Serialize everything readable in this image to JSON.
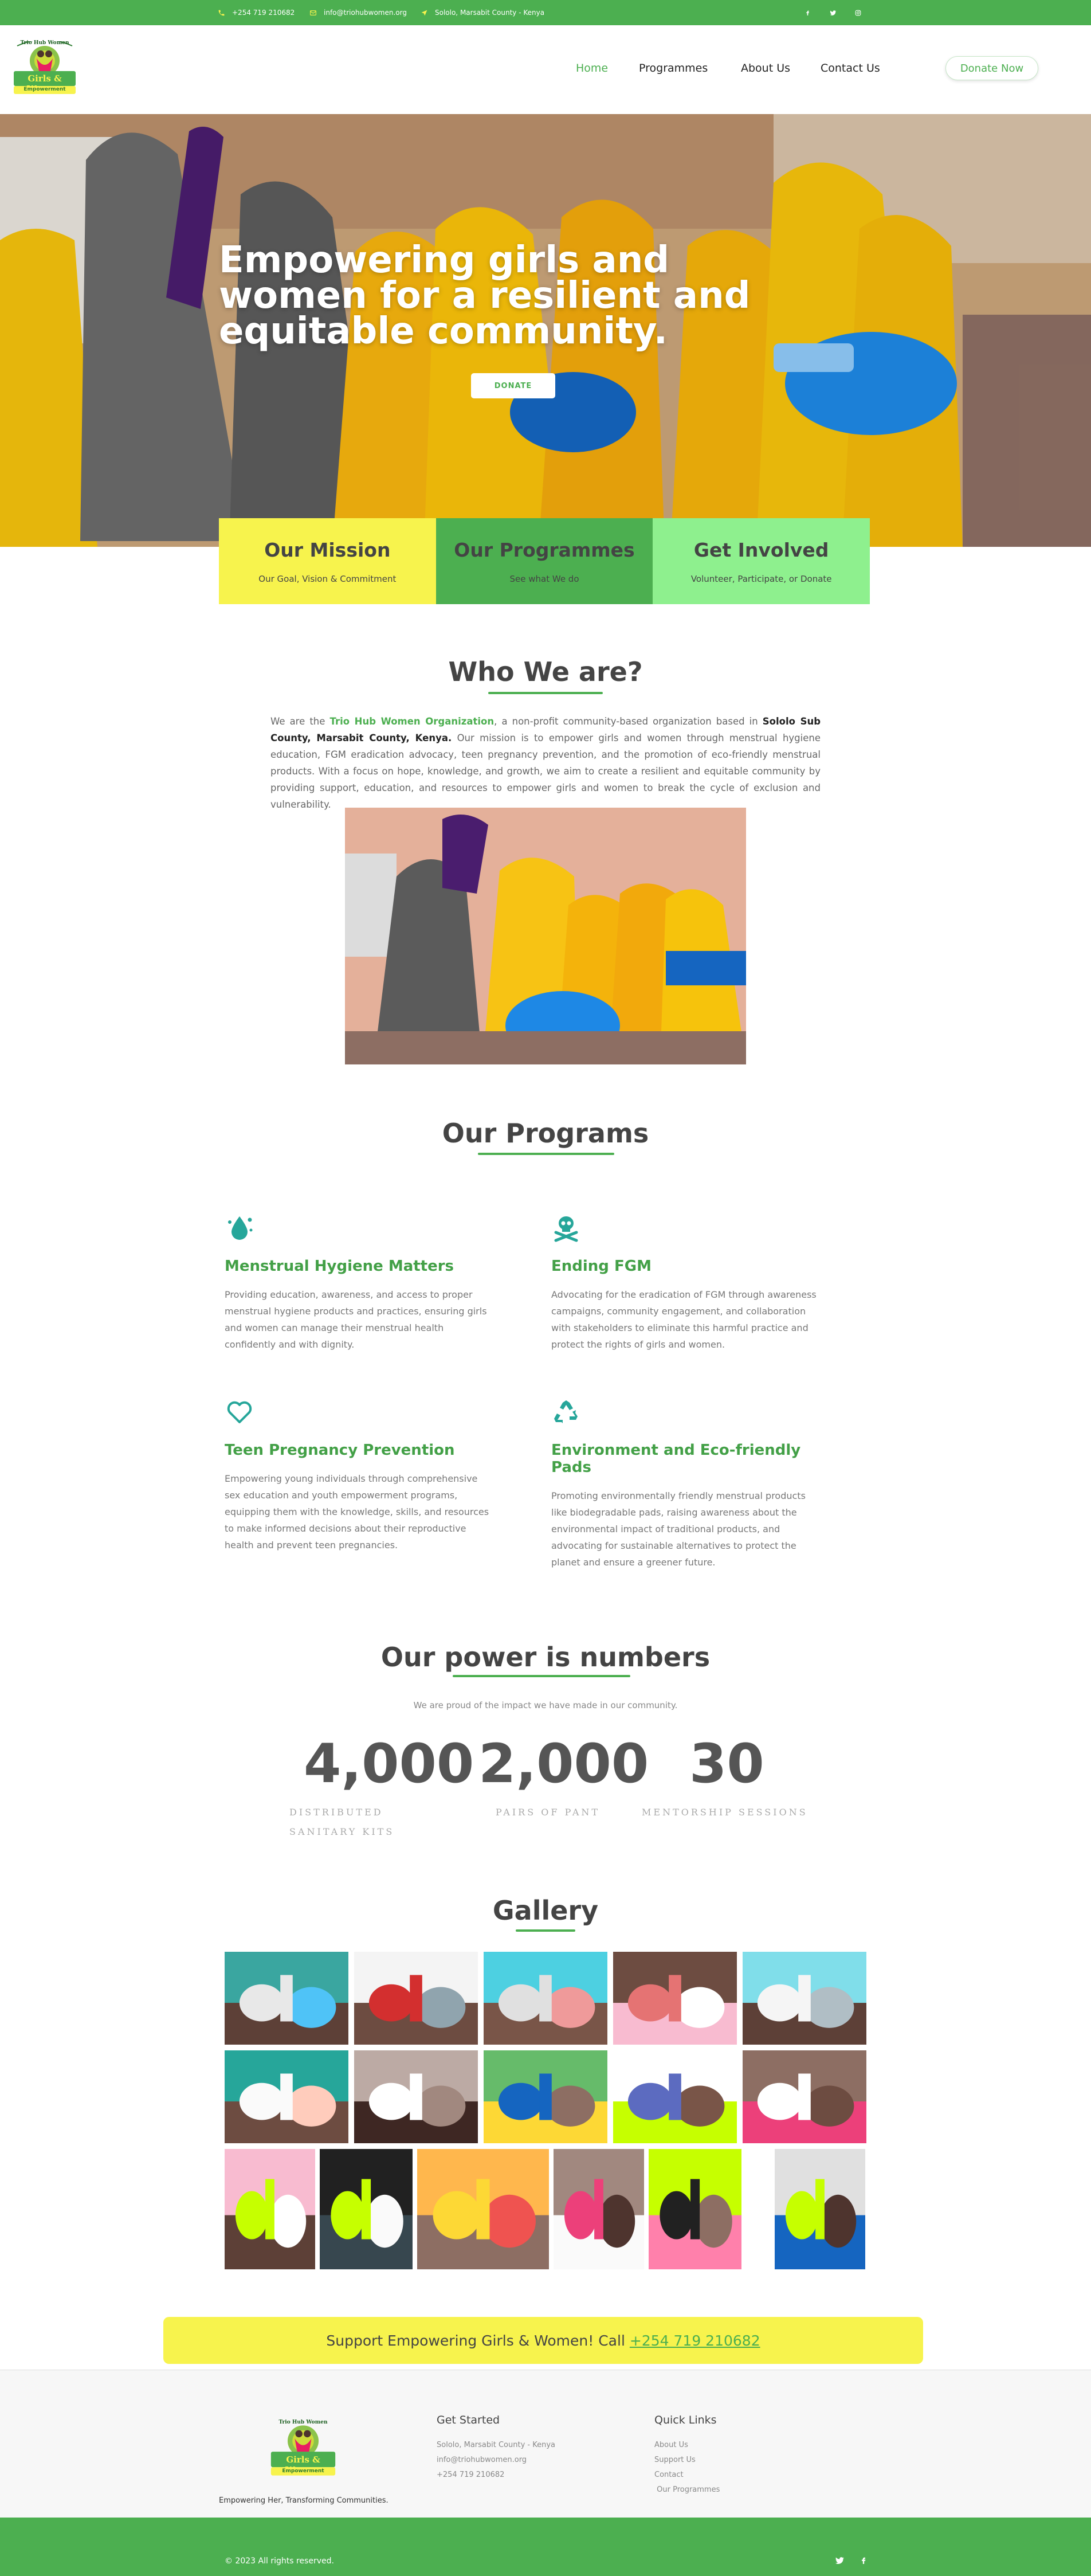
{
  "topbar": {
    "phone": "+254 719 210682",
    "email": "info@triohubwomen.org",
    "location": "Sololo, Marsabit County - Kenya",
    "social": [
      "facebook-icon",
      "twitter-icon",
      "instagram-icon"
    ]
  },
  "logo": {
    "line1": "Trio Hub Women",
    "line2": "Girls & Women",
    "line3": "Empowerment"
  },
  "nav": {
    "items": [
      "Home",
      "Programmes",
      "About Us",
      "Contact Us"
    ],
    "active": "Home",
    "donate_label": "Donate Now"
  },
  "hero": {
    "heading": "Empowering girls and women for a resilient and equitable community.",
    "button": "DONATE"
  },
  "cards": [
    {
      "title": "Our Mission",
      "subtitle": "Our Goal, Vision  & Commitment",
      "color": "#f7f34d"
    },
    {
      "title": "Our Programmes",
      "subtitle": "See what We do",
      "color": "#4caf50"
    },
    {
      "title": "Get Involved",
      "subtitle": "Volunteer, Participate, or Donate",
      "color": "#8ef08e"
    }
  ],
  "who": {
    "title": "Who We are?",
    "p_start": "We are the ",
    "org_link": "Trio Hub Women Organization",
    "p_mid": ", a non-profit community-based organization based in ",
    "location_bold": "Sololo Sub County, Marsabit County, Kenya.",
    "p_end": " Our mission is to empower girls and women through menstrual hygiene education, FGM eradication advocacy, teen pregnancy prevention, and the promotion of eco-friendly menstrual products. With a focus on hope, knowledge, and growth, we aim to create a resilient and equitable community by providing support, education, and resources to empower girls and women to break the cycle of exclusion and vulnerability."
  },
  "programs": {
    "title": "Our Programs",
    "items": [
      {
        "icon": "droplet-icon",
        "title": "Menstrual Hygiene Matters",
        "text": "Providing education, awareness, and access to proper menstrual hygiene products and practices, ensuring girls and women can manage their menstrual health confidently and with dignity."
      },
      {
        "icon": "skull-crossbones-icon",
        "title": "Ending FGM",
        "text": "Advocating for the eradication of FGM through awareness campaigns, community engagement, and collaboration with stakeholders to eliminate this harmful practice and protect the rights of girls and women."
      },
      {
        "icon": "heart-icon",
        "title": "Teen Pregnancy Prevention",
        "text": "Empowering young individuals through comprehensive sex education and youth empowerment programs, equipping them with the knowledge, skills, and resources to make informed decisions about their reproductive health and prevent teen pregnancies."
      },
      {
        "icon": "recycle-icon",
        "title": "Environment and Eco-friendly Pads",
        "text": "Promoting environmentally friendly menstrual products like biodegradable pads, raising awareness about the environmental impact of traditional products, and advocating for sustainable alternatives to protect the planet and ensure a greener future."
      }
    ]
  },
  "numbers": {
    "title": "Our power is numbers",
    "subtitle": "We are proud of the impact we have made in our community.",
    "stats": [
      {
        "value": "4,000",
        "label": "DISTRIBUTED SANITARY KITS"
      },
      {
        "value": "2,000",
        "label": "PAIRS OF PANT"
      },
      {
        "value": "30",
        "label": "MENTORSHIP SESSIONS"
      }
    ]
  },
  "gallery": {
    "title": "Gallery"
  },
  "cta": {
    "text": "Support Empowering Girls & Women! Call",
    "phone": "+254 719 210682"
  },
  "footer": {
    "tagline": "Empowering Her, Transforming Communities.",
    "get_started": {
      "title": "Get Started",
      "lines": [
        "Sololo, Marsabit County - Kenya",
        "info@triohubwomen.org",
        "+254 719 210682"
      ]
    },
    "quick_links": {
      "title": "Quick Links",
      "links": [
        "About Us",
        "Support Us",
        "Contact",
        " Our Programmes"
      ]
    },
    "copyright": "© 2023 All rights reserved.",
    "social": [
      "twitter-icon",
      "facebook-icon"
    ]
  },
  "colors": {
    "green": "#4caf50",
    "yellow": "#f7f34d",
    "light_green": "#8ef08e"
  }
}
